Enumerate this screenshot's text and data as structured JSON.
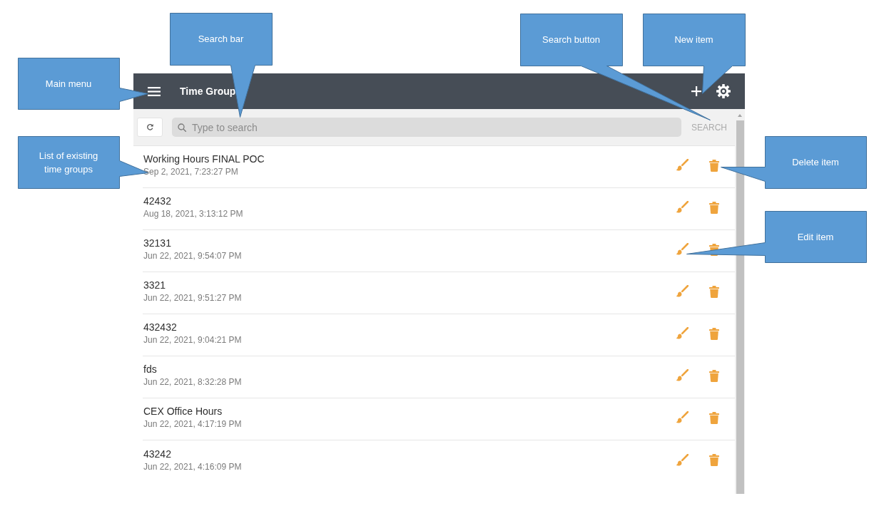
{
  "header": {
    "title": "Time Group"
  },
  "toolbar": {
    "search": {
      "placeholder": "Type to search"
    },
    "search_button": "SEARCH"
  },
  "time_groups": [
    {
      "name": "Working Hours FINAL POC",
      "date": "Sep 2, 2021, 7:23:27 PM"
    },
    {
      "name": "42432",
      "date": "Aug 18, 2021, 3:13:12 PM"
    },
    {
      "name": "32131",
      "date": "Jun 22, 2021, 9:54:07 PM"
    },
    {
      "name": "3321",
      "date": "Jun 22, 2021, 9:51:27 PM"
    },
    {
      "name": "432432",
      "date": "Jun 22, 2021, 9:04:21 PM"
    },
    {
      "name": "fds",
      "date": "Jun 22, 2021, 8:32:28 PM"
    },
    {
      "name": "CEX Office Hours",
      "date": "Jun 22, 2021, 4:17:19 PM"
    },
    {
      "name": "43242",
      "date": "Jun 22, 2021, 4:16:09 PM"
    }
  ],
  "callouts": [
    "Search bar",
    "Search button",
    "New item",
    "Main menu",
    "List of existing time groups",
    "Delete item",
    "Edit item"
  ]
}
